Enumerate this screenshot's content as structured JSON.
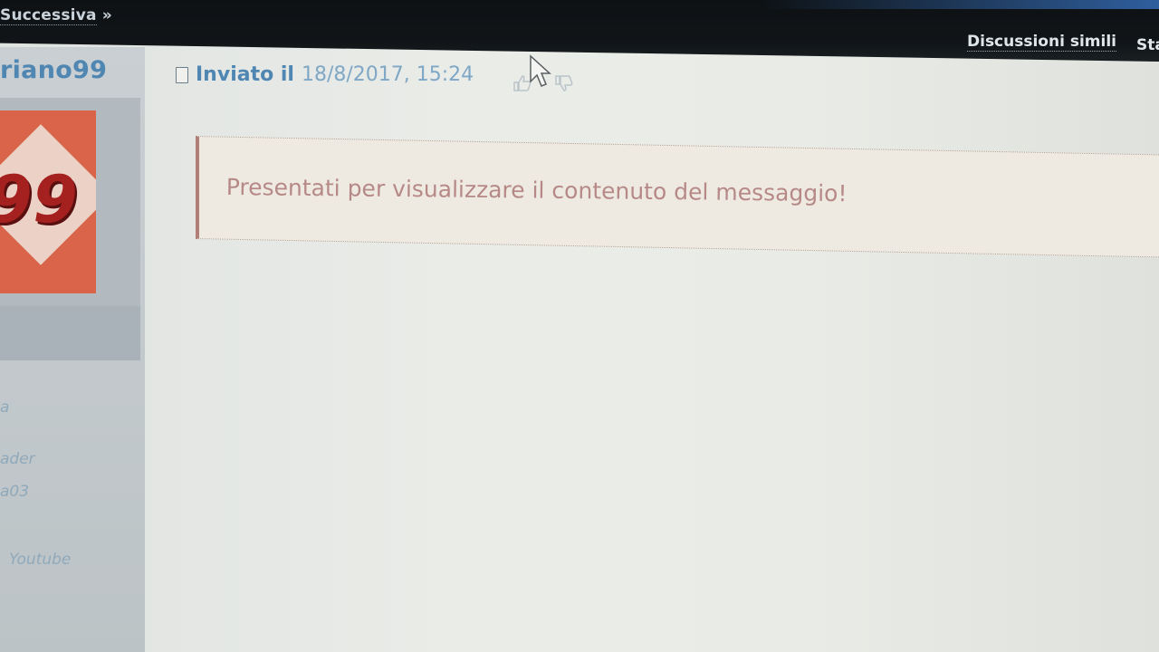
{
  "topbar": {
    "next_label": "Successiva",
    "next_arrow": "»",
    "similar_label": "Discussioni simili",
    "stat_label": "Sta"
  },
  "sidebar": {
    "username": "riano99",
    "avatar_text": "99",
    "link1": "a",
    "link2": "ader",
    "link3": "a03",
    "link4": "Youtube"
  },
  "post": {
    "sent_label": "Inviato il",
    "sent_date": "18/8/2017, 15:24",
    "message": "Presentati per visualizzare il contenuto del messaggio!"
  },
  "colors": {
    "link_blue": "#4f86b2",
    "message_text": "#b68987",
    "message_border": "#b07f78",
    "avatar_bg": "#d9644a"
  }
}
